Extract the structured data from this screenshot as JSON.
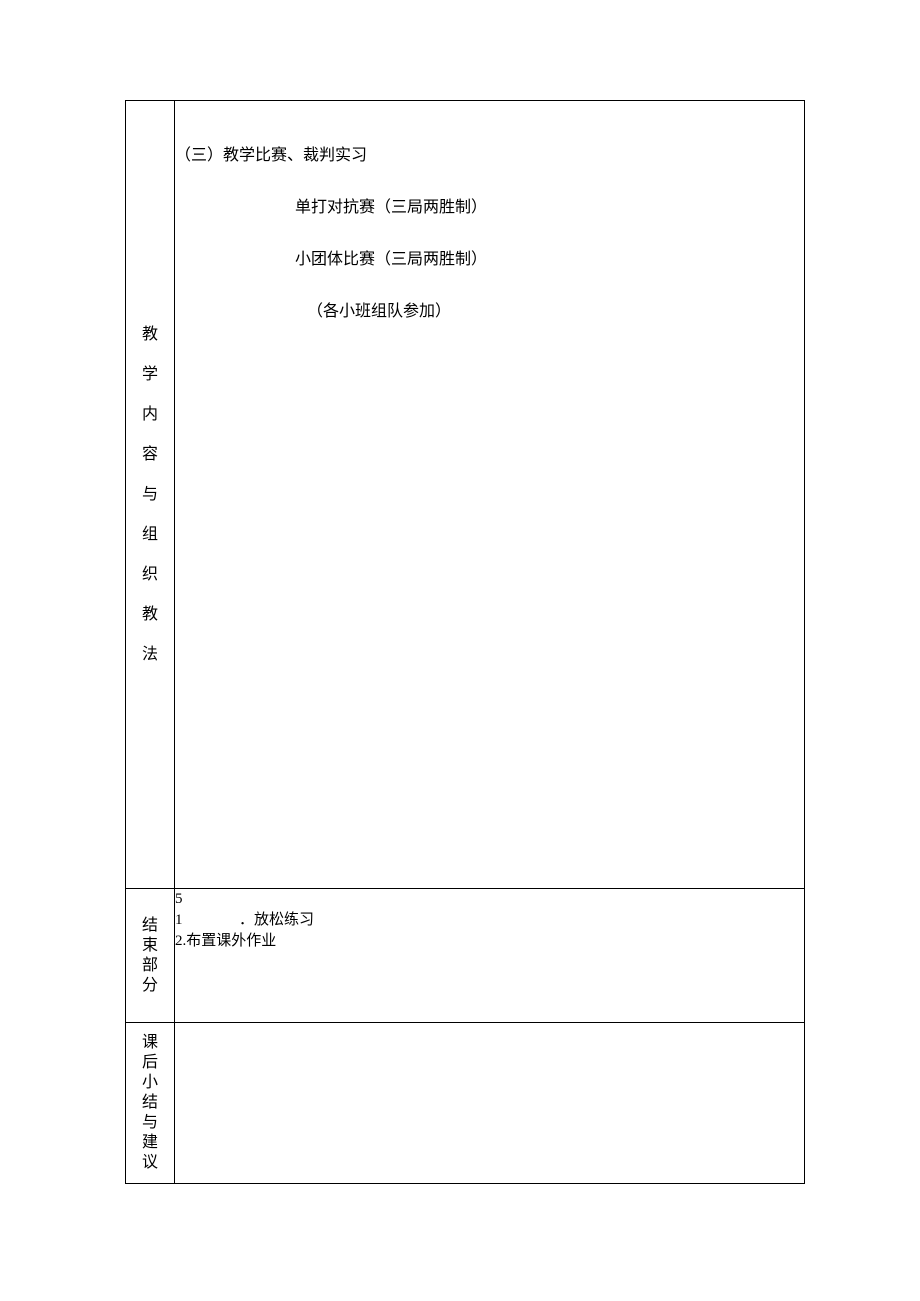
{
  "row1": {
    "label": [
      "教",
      "学",
      "内",
      "容",
      "与",
      "组",
      "织",
      "教",
      "法"
    ],
    "section_title": "（三）教学比赛、裁判实习",
    "line_a": "单打对抗赛（三局两胜制）",
    "line_b": "小团体比赛（三局两胜制）",
    "line_c": "（各小班组队参加）"
  },
  "row2": {
    "label": [
      "结",
      "束",
      "部",
      "分"
    ],
    "top_num": "5",
    "item1_num": "1",
    "item1_text": "．放松练习",
    "item2": "2.布置课外作业"
  },
  "row3": {
    "label": [
      "课",
      "后",
      "小",
      "结",
      "与",
      "建",
      "议"
    ]
  }
}
